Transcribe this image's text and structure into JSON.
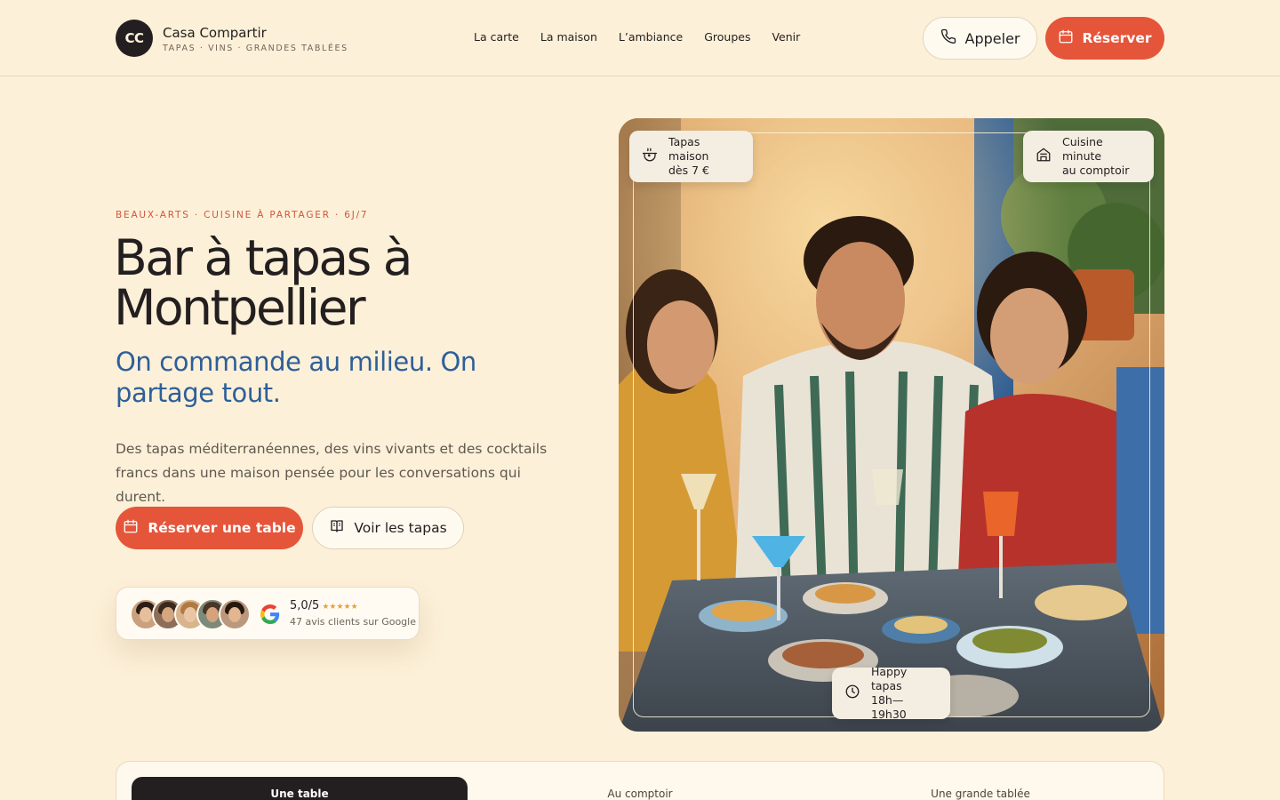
{
  "brand": {
    "logo": "CC",
    "name": "Casa Compartir",
    "tagline": "TAPAS · VINS · GRANDES TABLÉES"
  },
  "nav": {
    "items": [
      "La carte",
      "La maison",
      "L’ambiance",
      "Groupes",
      "Venir"
    ]
  },
  "header_actions": {
    "call_label": "Appeler",
    "call_icon": "phone-icon",
    "book_label": "Réserver",
    "book_icon": "calendar-icon"
  },
  "hero": {
    "eyebrow": "BEAUX-ARTS · CUISINE À PARTAGER · 6J/7",
    "title_line1": "Bar à tapas à",
    "title_line2": "Montpellier",
    "subtitle": "On commande au milieu. On partage tout.",
    "description": "Des tapas méditerranéennes, des vins vivants et des cocktails francs dans une maison pensée pour les conversations qui durent.",
    "cta_primary": "Réserver une table",
    "cta_secondary": "Voir les tapas"
  },
  "reviews": {
    "score": "5,0/5",
    "stars": "★★★★★",
    "count_text": "47 avis clients sur Google"
  },
  "photo_badges": [
    {
      "icon": "cooking-pot-icon",
      "line1": "Tapas maison",
      "line2": "dès 7 €"
    },
    {
      "icon": "storefront-icon",
      "line1": "Cuisine minute",
      "line2": "au comptoir"
    },
    {
      "icon": "clock-icon",
      "line1": "Happy tapas",
      "line2": "18h—19h30"
    }
  ],
  "tabs": [
    {
      "label": "Une table",
      "active": true
    },
    {
      "label": "Au comptoir",
      "active": false
    },
    {
      "label": "Une grande tablée",
      "active": false
    }
  ],
  "colors": {
    "background": "#fdf0d8",
    "accent": "#e5553a",
    "blue": "#2d5f9a",
    "ink": "#231f20"
  }
}
